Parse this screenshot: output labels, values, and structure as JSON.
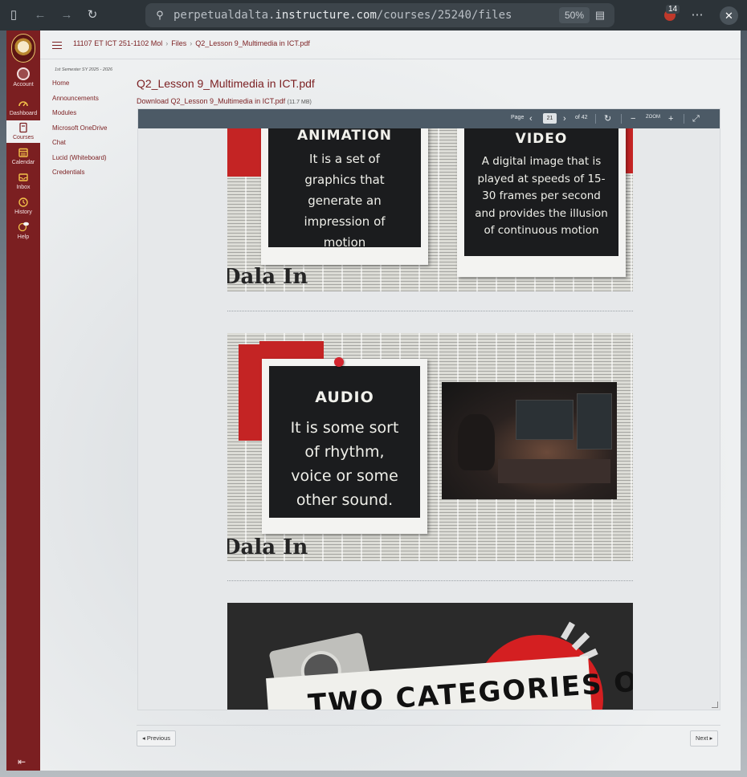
{
  "browser": {
    "url_prefix": "perpetualdalta.",
    "url_host": "instructure.com",
    "url_path": "/courses/25240/files",
    "zoom": "50%",
    "extension_badge": "14"
  },
  "nav": {
    "items": [
      {
        "label": "Account"
      },
      {
        "label": "Dashboard"
      },
      {
        "label": "Courses"
      },
      {
        "label": "Calendar"
      },
      {
        "label": "Inbox"
      },
      {
        "label": "History"
      },
      {
        "label": "Help"
      }
    ]
  },
  "breadcrumbs": [
    "11107 ET ICT 251-1102 Mol",
    "Files",
    "Q2_Lesson 9_Multimedia in ICT.pdf"
  ],
  "course_nav": {
    "term": "1st Semester SY 2025 - 2026",
    "links": [
      "Home",
      "Announcements",
      "Modules",
      "Microsoft OneDrive",
      "Chat",
      "Lucid (Whiteboard)",
      "Credentials"
    ]
  },
  "file": {
    "title": "Q2_Lesson 9_Multimedia in ICT.pdf",
    "download_label": "Download Q2_Lesson 9_Multimedia in ICT.pdf",
    "size": "(11.7 MB)"
  },
  "pdf_toolbar": {
    "page_label": "Page",
    "current_page": "21",
    "total": "of 42",
    "zoom_label": "ZOOM"
  },
  "slides": {
    "animation": {
      "title": "ANIMATION",
      "body": "It is a set of graphics that generate an impression of motion"
    },
    "video": {
      "title": "VIDEO",
      "body": "A digital image that is played at speeds of 15-30 frames per second and provides the illusion of continuous motion"
    },
    "audio": {
      "title": "AUDIO",
      "body": "It is some sort of rhythm, voice or some other sound."
    },
    "categories": {
      "title": "TWO CATEGORIES OF"
    },
    "masthead": "Dala In"
  },
  "pager": {
    "prev": "◂ Previous",
    "next": "Next ▸"
  }
}
